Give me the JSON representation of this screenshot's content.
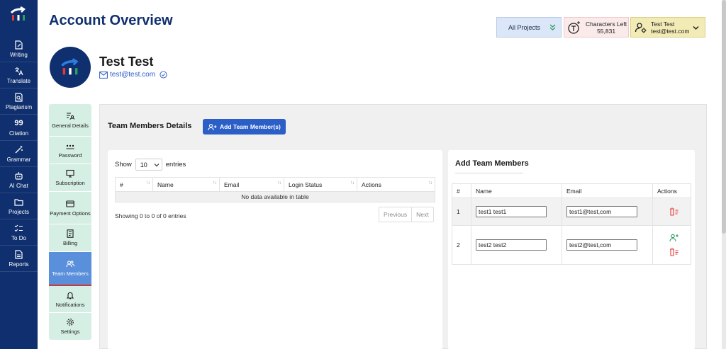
{
  "nav": {
    "items": [
      {
        "label": "Writing",
        "icon": "writing-icon"
      },
      {
        "label": "Translate",
        "icon": "translate-icon"
      },
      {
        "label": "Plagiarism",
        "icon": "plagiarism-icon"
      },
      {
        "label": "Citation",
        "icon": "citation-icon",
        "glyph": "99"
      },
      {
        "label": "Grammar",
        "icon": "grammar-icon"
      },
      {
        "label": "AI Chat",
        "icon": "ai-chat-icon"
      },
      {
        "label": "Projects",
        "icon": "folder-icon"
      },
      {
        "label": "To Do",
        "icon": "todo-icon"
      },
      {
        "label": "Reports",
        "icon": "reports-icon"
      }
    ]
  },
  "header": {
    "title": "Account Overview",
    "project_select": "All Projects",
    "chars_label": "Characters Left",
    "chars_value": "55,831",
    "user_name": "Test Test",
    "user_email": "test@test.com"
  },
  "profile": {
    "name": "Test Test",
    "email": "test@test.com"
  },
  "settings": {
    "items": [
      {
        "label": "General Details",
        "icon": "general-details-icon",
        "active": false
      },
      {
        "label": "Password",
        "icon": "password-icon",
        "active": false
      },
      {
        "label": "Subscription",
        "icon": "subscription-icon",
        "active": false
      },
      {
        "label": "Payment Options",
        "icon": "payment-icon",
        "active": false
      },
      {
        "label": "Billing",
        "icon": "billing-icon",
        "active": false
      },
      {
        "label": "Team Members",
        "icon": "team-icon",
        "active": true
      },
      {
        "label": "Notifications",
        "icon": "bell-icon",
        "active": false
      },
      {
        "label": "Settings",
        "icon": "gear-icon",
        "active": false
      }
    ]
  },
  "team": {
    "title": "Team Members Details",
    "add_button": "Add Team Member(s)",
    "show_label": "Show",
    "entries_value": "10",
    "entries_label": "entries",
    "columns": [
      "#",
      "Name",
      "Email",
      "Login Status",
      "Actions"
    ],
    "empty_text": "No data available in table",
    "info_text": "Showing 0 to 0 of 0 entries",
    "prev_label": "Previous",
    "next_label": "Next"
  },
  "add_members": {
    "title": "Add Team Members",
    "columns": [
      "#",
      "Name",
      "Email",
      "Actions"
    ],
    "rows": [
      {
        "num": "1",
        "name": "test1 test1",
        "email": "test1@test,com"
      },
      {
        "num": "2",
        "name": "test2 test2",
        "email": "test2@test,com"
      }
    ]
  },
  "colors": {
    "nav_bg": "#0f2f6e",
    "accent": "#2b5ec7",
    "settings_bg": "#d6efe4",
    "active_item": "#5a8fdb",
    "delete": "#e53935",
    "add_user": "#2e9e5b"
  }
}
